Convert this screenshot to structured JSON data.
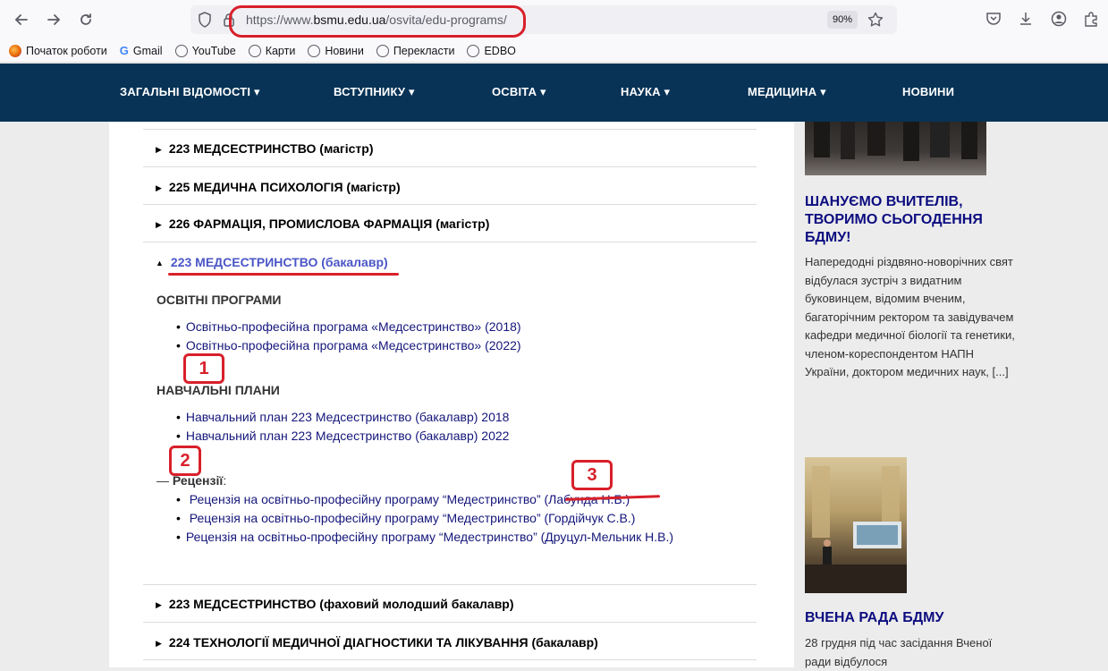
{
  "browser": {
    "url_prefix": "https://www.",
    "url_domain": "bsmu.edu.ua",
    "url_path": "/osvita/edu-programs/",
    "zoom": "90%",
    "bookmarks": [
      {
        "label": "Початок роботи",
        "icon_color": "#e66000"
      },
      {
        "label": "Gmail",
        "icon_color": "#4285f4"
      },
      {
        "label": "YouTube",
        "icon_color": "#888888"
      },
      {
        "label": "Карти",
        "icon_color": "#888888"
      },
      {
        "label": "Новини",
        "icon_color": "#888888"
      },
      {
        "label": "Перекласти",
        "icon_color": "#888888"
      },
      {
        "label": "EDBO",
        "icon_color": "#888888"
      }
    ]
  },
  "site_nav": {
    "items": [
      {
        "label": "ЗАГАЛЬНІ ВІДОМОСТІ ▾"
      },
      {
        "label": "ВСТУПНИКУ ▾"
      },
      {
        "label": "ОСВІТА ▾"
      },
      {
        "label": "НАУКА ▾"
      },
      {
        "label": "МЕДИЦИНА ▾"
      },
      {
        "label": "НОВИНИ"
      }
    ],
    "bg_color": "#083356"
  },
  "accordion": {
    "closed_top": [
      {
        "title": "223 МЕДСЕСТРИНСТВО",
        "suffix": "(магістр)"
      },
      {
        "title": "225 МЕДИЧНА ПСИХОЛОГІЯ",
        "suffix": "(магістр)"
      },
      {
        "title": "226 ФАРМАЦІЯ, ПРОМИСЛОВА ФАРМАЦІЯ",
        "suffix": "(магістр)"
      }
    ],
    "open": {
      "title": "223 МЕДСЕСТРИНСТВО (бакалавр)",
      "programs_heading": "ОСВІТНІ ПРОГРАМИ",
      "programs": [
        "Освітньо-професійна програма «Медсестринство» (2018)",
        "Освітньо-професійна програма «Медсестринство» (2022)"
      ],
      "plans_heading": "НАВЧАЛЬНІ ПЛАНИ",
      "plans": [
        "Навчальний план 223 Медсестринство (бакалавр) 2018",
        "Навчальний план 223 Медсестринство (бакалавр) 2022"
      ],
      "reviews_prefix": "— ",
      "reviews_heading": "Рецензії",
      "reviews_colon": ":",
      "reviews": [
        "Рецензія на освітньо-професійну програму “Медестринство” (Лабунда Н.Б.)",
        "Рецензія на освітньо-професійну програму “Медестринство” (Гордійчук С.В.)",
        "Рецензія на освітньо-професійну програму “Медестринство” (Друцул-Мельник Н.В.)"
      ]
    },
    "closed_bottom": [
      {
        "title": "223 МЕДСЕСТРИНСТВО",
        "suffix": "(фаховий молодший бакалавр)"
      },
      {
        "title": "224 ТЕХНОЛОГІЇ МЕДИЧНОЇ ДІАГНОСТИКИ ТА ЛІКУВАННЯ",
        "suffix": "(бакалавр)"
      }
    ]
  },
  "annotations": [
    "1",
    "2",
    "3"
  ],
  "sidebar": {
    "news1": {
      "title": "ШАНУЄМО ВЧИТЕЛІВ, ТВОРИМО СЬОГОДЕННЯ БДМУ!",
      "text": "Напередодні різдвяно-новорічних свят відбулася зустріч з видатним буковинцем, відомим вченим, багаторічним ректором та завідувачем кафедри медичної біології та генетики, членом-кореспондентом НАПН України, доктором медичних наук, [...]"
    },
    "news2": {
      "title": "ВЧЕНА РАДА БДМУ",
      "text": "28 грудня під час засідання Вченої ради відбулося"
    }
  }
}
